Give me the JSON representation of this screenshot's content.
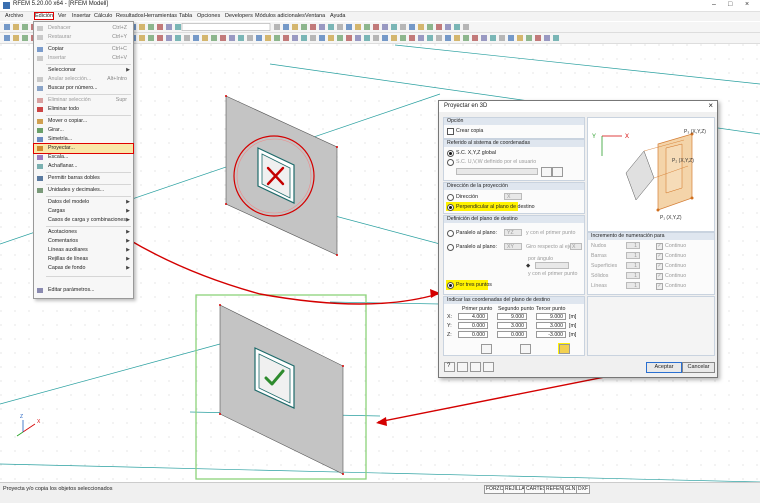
{
  "app": {
    "title": "RFEM 5.20.00 x64 - [RFEM Modell]",
    "window_controls": [
      "–",
      "□",
      "×"
    ]
  },
  "menubar": [
    "Archivo",
    "Edición",
    "Ver",
    "Insertar",
    "Cálculo",
    "Resultados",
    "Herramientas",
    "Tabla",
    "Opciones",
    "Developers",
    "Módulos adicionales",
    "Ventana",
    "Ayuda"
  ],
  "edit_menu": {
    "items": [
      {
        "label": "Deshacer",
        "shortcut": "Ctrl+Z",
        "disabled": true,
        "icon": "undo-icon"
      },
      {
        "label": "Restaurar",
        "shortcut": "Ctrl+Y",
        "disabled": true,
        "icon": "redo-icon"
      },
      {
        "label": "Copiar",
        "shortcut": "Ctrl+C",
        "disabled": false,
        "icon": "copy-icon"
      },
      {
        "label": "Insertar",
        "shortcut": "Ctrl+V",
        "disabled": true,
        "icon": "paste-icon"
      },
      {
        "label": "Seleccionar",
        "submenu": true,
        "disabled": false
      },
      {
        "label": "Anular selección...",
        "shortcut": "Alt+Intro",
        "disabled": true,
        "icon": "deselect-icon"
      },
      {
        "label": "Buscar por número...",
        "disabled": false,
        "icon": "find-icon"
      },
      {
        "label": "Eliminar selección",
        "shortcut": "Supr",
        "disabled": true,
        "icon": "delete-selection-icon"
      },
      {
        "label": "Eliminar todo",
        "disabled": false,
        "icon": "delete-all-icon"
      },
      {
        "label": "Mover o copiar...",
        "disabled": false,
        "icon": "move-icon"
      },
      {
        "label": "Girar...",
        "disabled": false,
        "icon": "rotate-icon"
      },
      {
        "label": "Simetría...",
        "disabled": false,
        "icon": "mirror-icon"
      },
      {
        "label": "Proyectar...",
        "disabled": false,
        "icon": "project-icon",
        "highlighted": true
      },
      {
        "label": "Escala...",
        "disabled": false,
        "icon": "scale-icon"
      },
      {
        "label": "Achaflanar...",
        "disabled": false,
        "icon": "chamfer-icon"
      },
      {
        "label": "Permitir barras dobles",
        "disabled": false,
        "icon": "double-bar-icon"
      },
      {
        "label": "Unidades y decimales...",
        "disabled": false,
        "icon": "units-icon"
      },
      {
        "label": "Datos del modelo",
        "submenu": true,
        "disabled": false
      },
      {
        "label": "Cargas",
        "submenu": true,
        "disabled": false
      },
      {
        "label": "Casos de carga y combinaciones",
        "submenu": true,
        "disabled": false
      },
      {
        "label": "Acotaciones",
        "submenu": true,
        "disabled": false
      },
      {
        "label": "Comentarios",
        "submenu": true,
        "disabled": false
      },
      {
        "label": "Líneas auxiliares",
        "submenu": true,
        "disabled": false
      },
      {
        "label": "Rejillas de líneas",
        "submenu": true,
        "disabled": false
      },
      {
        "label": "Capas de fondo",
        "submenu": true,
        "disabled": false
      },
      {
        "label": "Editar parámetros...",
        "disabled": false,
        "icon": "edit-params-icon"
      }
    ]
  },
  "dialog": {
    "title": "Proyectar en 3D",
    "opcion": {
      "header": "Opción",
      "crear_copia": "Crear copia"
    },
    "referido": {
      "header": "Referido al sistema de coordenadas",
      "global": "S.C. X,Y,Z global",
      "usuario": "S.C. U,V,W definido por el usuario"
    },
    "direccion": {
      "header": "Dirección de la proyección",
      "direccion": "Dirección",
      "direccion_value": "X",
      "perpendicular": "Perpendicular al plano de destino"
    },
    "definicion": {
      "header": "Definición del plano de destino",
      "paralelo": "Paralelo al plano:",
      "paralelo_value": "YZ",
      "paralelo_hint": "y con el primer punto",
      "girado": "Paralelo al plano:",
      "girado_value": "XY",
      "girado_hint": "Giro respecto al eje:",
      "girado_axis": "X",
      "por_angulo": "por ángulo",
      "angle_hint": "y con el primer punto",
      "tres_puntos": "Por tres puntos"
    },
    "incremento": {
      "header": "Incremento de numeración para",
      "rows": [
        {
          "label": "Nudos",
          "value": "1",
          "check": "Continuo"
        },
        {
          "label": "Barras",
          "value": "1",
          "check": "Continuo"
        },
        {
          "label": "Superficies",
          "value": "1",
          "check": "Continuo"
        },
        {
          "label": "Sólidos",
          "value": "1",
          "check": "Continuo"
        },
        {
          "label": "Líneas",
          "value": "1",
          "check": "Continuo"
        }
      ]
    },
    "coords": {
      "header": "Indicar las coordenadas del plano de destino",
      "cols": [
        "Primer punto",
        "Segundo punto",
        "Tercer punto"
      ],
      "rows": [
        {
          "axis": "X:",
          "p1": "4.000",
          "p2": "9.000",
          "p3": "9.000",
          "unit": "[m]"
        },
        {
          "axis": "Y:",
          "p1": "0.000",
          "p2": "3.000",
          "p3": "3.000",
          "unit": "[m]"
        },
        {
          "axis": "Z:",
          "p1": "0.000",
          "p2": "0.000",
          "p3": "-3.000",
          "unit": "[m]"
        }
      ]
    },
    "preview": {
      "p1": "P₁ (X,Y,Z)",
      "p2": "P₂ (X,Y,Z)",
      "p3": "P₃ (X,Y,Z)",
      "axis_x": "X",
      "axis_y": "Y"
    },
    "buttons": {
      "accept": "Aceptar",
      "cancel": "Cancelar"
    }
  },
  "canvas": {
    "axis_x": "X",
    "axis_z": "Z"
  },
  "status": {
    "text": "Proyecta y/o copia los objetos seleccionados",
    "buttons": [
      "FORZC",
      "REJILLA",
      "CARTES",
      "REFENT",
      "GLN",
      "DXF"
    ]
  },
  "colors": {
    "accent_red": "#d40000",
    "highlight_yellow": "#fff200",
    "selection_green": "#4caf50",
    "menu_highlight": "#f9e7a9"
  }
}
